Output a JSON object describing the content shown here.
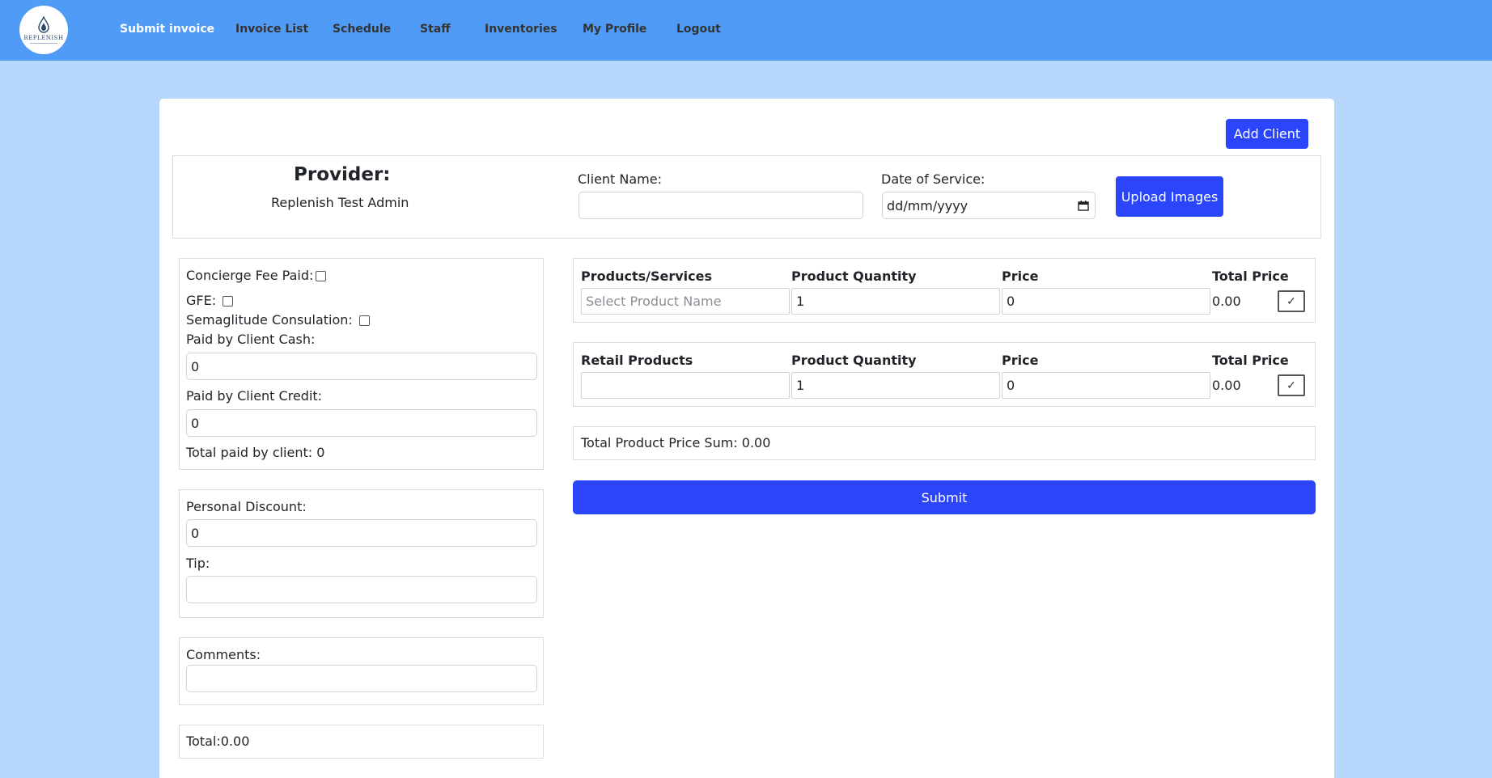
{
  "nav": {
    "logo_text": "REPLENISH",
    "items": [
      {
        "label": "Submit invoice"
      },
      {
        "label": "Invoice List"
      },
      {
        "label": "Schedule"
      },
      {
        "label": "Staff"
      },
      {
        "label": "Inventories"
      },
      {
        "label": "My Profile"
      },
      {
        "label": "Logout"
      }
    ]
  },
  "header": {
    "add_client_label": "Add Client",
    "provider_title": "Provider:",
    "provider_name": "Replenish Test Admin",
    "client_name_label": "Client Name:",
    "client_name_value": "",
    "date_label": "Date of Service:",
    "date_placeholder": "dd/mm/yyyy",
    "upload_label": "Upload Images"
  },
  "payments": {
    "concierge_label": "Concierge Fee Paid:",
    "gfe_label": "GFE:",
    "semaglutide_label": "Semaglitude Consulation:",
    "cash_label": "Paid by Client Cash:",
    "cash_value": "0",
    "credit_label": "Paid by Client Credit:",
    "credit_value": "0",
    "total_paid": "Total paid by client: 0"
  },
  "discounts": {
    "discount_label": "Personal Discount:",
    "discount_value": "0",
    "tip_label": "Tip:",
    "tip_value": ""
  },
  "comments": {
    "label": "Comments:",
    "value": ""
  },
  "total": "Total:0.00",
  "products": {
    "headers": [
      "Products/Services",
      "Product Quantity",
      "Price",
      "Total Price"
    ],
    "name_placeholder": "Select Product Name",
    "quantity": "1",
    "price": "0",
    "total": "0.00",
    "check_symbol": "✓"
  },
  "retail": {
    "headers": [
      "Retail Products",
      "Product Quantity",
      "Price",
      "Total Price"
    ],
    "name_value": "",
    "quantity": "1",
    "price": "0",
    "total": "0.00",
    "check_symbol": "✓"
  },
  "sum_label": "Total Product Price Sum: 0.00",
  "submit_label": "Submit",
  "colors": {
    "navbar": "#4f9bf6",
    "page_bg": "#b6d6fb",
    "primary_button": "#2b45fb"
  }
}
